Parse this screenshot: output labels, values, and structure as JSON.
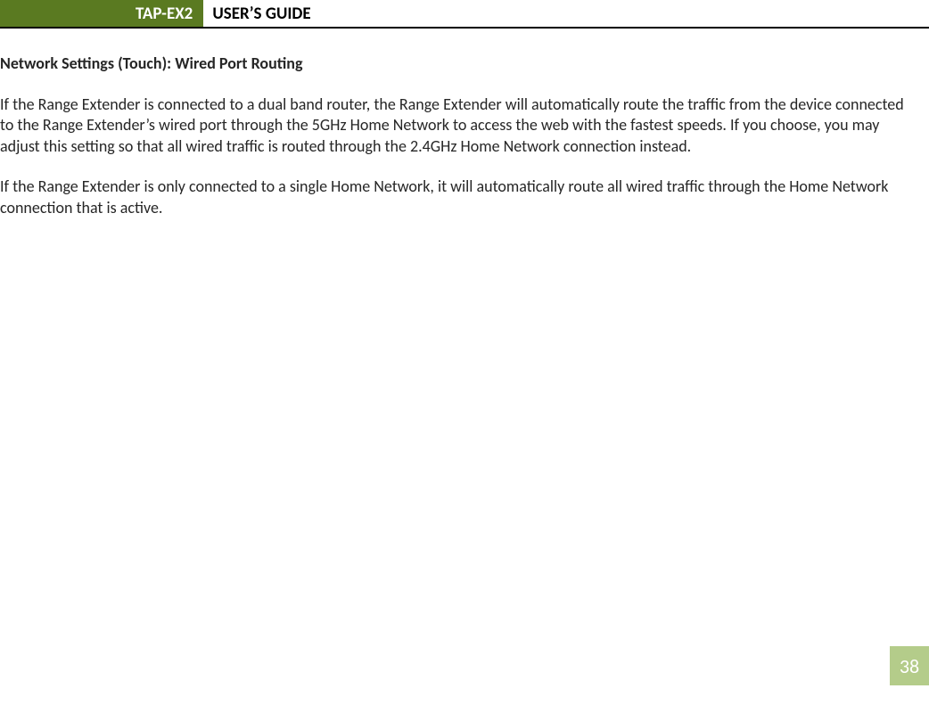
{
  "header": {
    "product": "TAP-EX2",
    "title": "USER’S GUIDE"
  },
  "section": {
    "heading": "Network Settings (Touch): Wired Port Routing"
  },
  "paragraphs": {
    "p1": "If the Range Extender is connected to a dual band router, the Range Extender will automatically route the traffic from the device connected to the Range Extender’s wired port through the 5GHz Home Network to access the web with the fastest speeds. If you choose, you may adjust this setting so that all wired traffic is routed through the 2.4GHz Home Network connection instead.",
    "p2": "If the Range Extender is only connected to a single Home Network, it will automatically route all wired traffic through the Home Network connection that is active."
  },
  "page_number": "38"
}
